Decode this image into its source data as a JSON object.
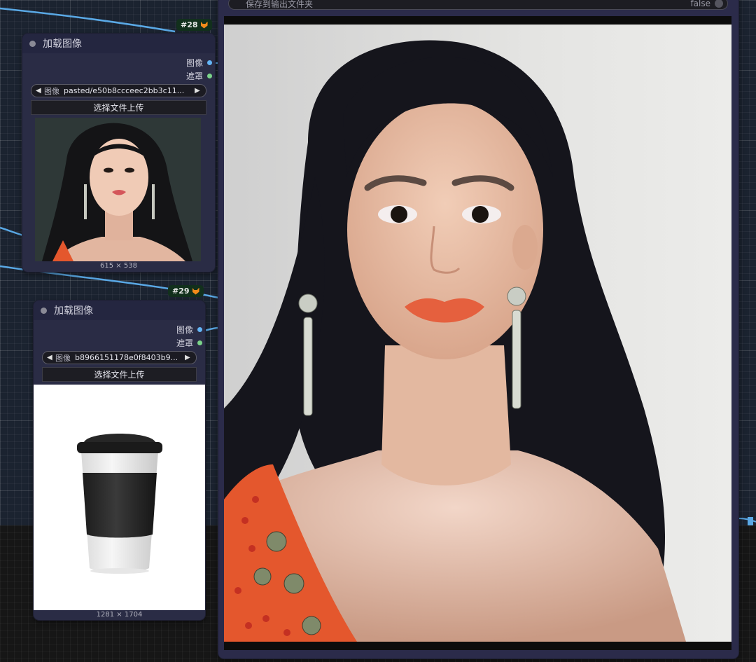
{
  "nodes": [
    {
      "id": "#28",
      "title": "加载图像",
      "outputs": [
        "图像",
        "遮罩"
      ],
      "combo_label": "图像",
      "combo_value": "pasted/e50b8ccceec2bb3c11...",
      "upload_label": "选择文件上传",
      "image_size": "615 × 538"
    },
    {
      "id": "#29",
      "title": "加载图像",
      "outputs": [
        "图像",
        "遮罩"
      ],
      "combo_label": "图像",
      "combo_value": "b8966151178e0f8403b9...",
      "upload_label": "选择文件上传",
      "image_size": "1281 × 1704"
    }
  ],
  "preview_node": {
    "save_label": "保存到输出文件夹",
    "save_value": "false"
  },
  "colors": {
    "node_bg": "#2a2c45",
    "link_blue": "#64b5f6",
    "mask_green": "#7bd48a",
    "badge_bg": "#12301c"
  },
  "icons": {
    "badge": "fox-icon",
    "combo_left": "arrow-left-icon",
    "combo_right": "arrow-right-icon"
  }
}
